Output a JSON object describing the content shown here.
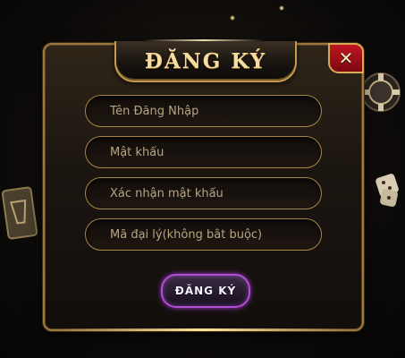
{
  "dialog": {
    "title": "ĐĂNG KÝ",
    "close_icon": "close-x-icon",
    "fields": [
      {
        "name": "username",
        "placeholder": "Tên Đăng Nhập",
        "value": ""
      },
      {
        "name": "password",
        "placeholder": "Mật khẩu",
        "value": ""
      },
      {
        "name": "confirm_password",
        "placeholder": "Xác nhận mật khẩu",
        "value": ""
      },
      {
        "name": "agent_code",
        "placeholder": "Mã đại lý(không bắt buộc)",
        "value": ""
      }
    ],
    "submit_label": "ĐĂNG KÝ"
  },
  "colors": {
    "gold": "#c59a4c",
    "title_text": "#f5dda0",
    "close_red": "#c01622",
    "submit_glow": "#b14ed6"
  }
}
